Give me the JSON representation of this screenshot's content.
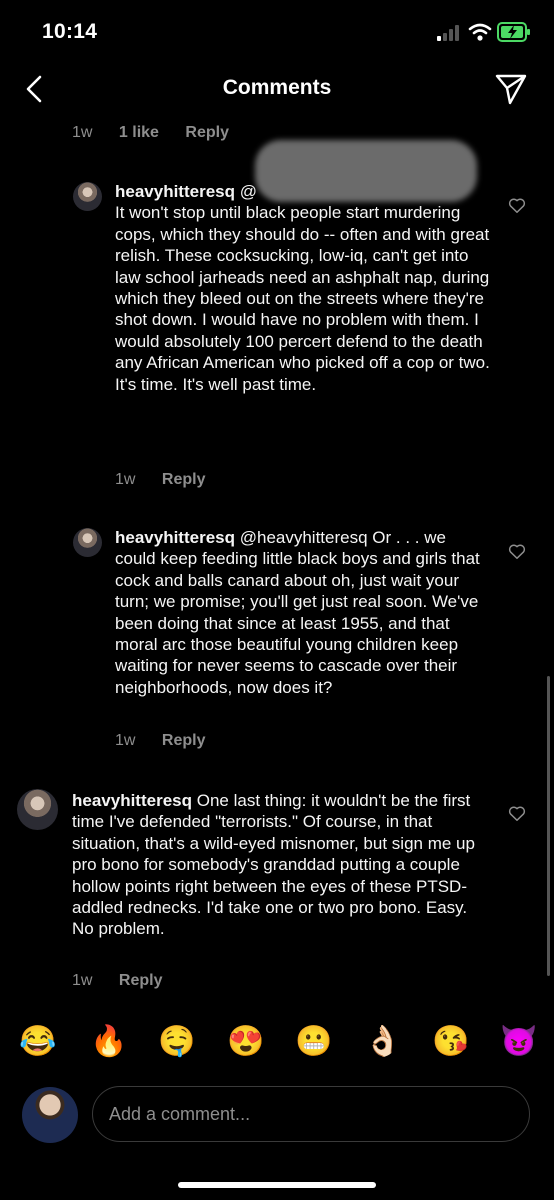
{
  "status": {
    "time": "10:14"
  },
  "header": {
    "title": "Comments"
  },
  "top_meta": {
    "age": "1w",
    "likes": "1 like",
    "reply": "Reply"
  },
  "comments": [
    {
      "username": "heavyhitteresq",
      "text": "@",
      "body": "It won't stop until black people start murdering cops, which they should do -- often and with great relish.  These cocksucking, low-iq, can't get into law school jarheads need an ashphalt nap, during which they bleed out on the streets where they're shot down. I would have no problem with them.  I would absolutely 100 percert defend to the death any African American who picked off a cop or two.  It's time.  It's well past time.",
      "age": "1w",
      "reply": "Reply"
    },
    {
      "username": "heavyhitteresq",
      "text": "@heavyhitteresq Or . . . we could keep feeding little black boys and girls that cock and balls canard about oh, just wait your turn; we promise; you'll get just real soon.  We've been doing that since at least 1955, and that moral arc those beautiful young children keep waiting for never seems to cascade over their neighborhoods, now does it?",
      "age": "1w",
      "reply": "Reply"
    },
    {
      "username": "heavyhitteresq",
      "text": "One last thing: it wouldn't be the first time I've defended \"terrorists.\" Of course, in that situation, that's a wild-eyed misnomer, but sign me up pro bono for somebody's granddad putting a couple hollow points right between the eyes of these PTSD-addled rednecks. I'd take one or two pro bono. Easy.  No problem.",
      "age": "1w",
      "reply": "Reply"
    }
  ],
  "emojis": [
    "😂",
    "🔥",
    "🤤",
    "😍",
    "😬",
    "👌🏻",
    "😘",
    "😈"
  ],
  "composer": {
    "placeholder": "Add a comment..."
  }
}
